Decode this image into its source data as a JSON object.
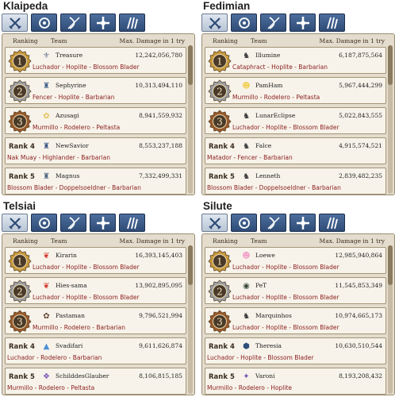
{
  "header": {
    "ranking": "Ranking",
    "team": "Team",
    "damage": "Max. Damage in 1 try"
  },
  "tabs": [
    {
      "icon": "swords-icon"
    },
    {
      "icon": "wizard-icon"
    },
    {
      "icon": "bow-icon"
    },
    {
      "icon": "cross-icon"
    },
    {
      "icon": "thief-icon"
    }
  ],
  "servers": [
    {
      "name": "Klaipeda",
      "rows": [
        {
          "rank": "1",
          "team": "Treasure",
          "damage": "12,242,056,780",
          "classes": "Luchador - Hoplite - Blossom Blader",
          "icon_color": "#6f7f93",
          "icon_glyph": "⚜"
        },
        {
          "rank": "2",
          "team": "Sephyrine",
          "damage": "10,313,494,110",
          "classes": "Fencer - Hoplite - Barbarian",
          "icon_color": "#3f5f8a",
          "icon_glyph": "♜"
        },
        {
          "rank": "3",
          "team": "Azusagi",
          "damage": "8,941,559,932",
          "classes": "Murmillo - Rodelero - Peltasta",
          "icon_color": "#e5c25a",
          "icon_glyph": "✿"
        },
        {
          "rank": "Rank 4",
          "team": "NewSavior",
          "damage": "8,553,237,188",
          "classes": "Nak Muay - Highlander - Barbarian",
          "icon_color": "#3a5686",
          "icon_glyph": "♜"
        },
        {
          "rank": "Rank 5",
          "team": "Magnus",
          "damage": "7,332,499,331",
          "classes": "Blossom Blader - Doppelsoeldner - Barbarian",
          "icon_color": "#4a6082",
          "icon_glyph": "♜"
        }
      ]
    },
    {
      "name": "Fedimian",
      "rows": [
        {
          "rank": "1",
          "team": "Illumine",
          "damage": "6,187,875,564",
          "classes": "Cataphract - Hoplite - Barbarian",
          "icon_color": "#3b3b3b",
          "icon_glyph": "♞"
        },
        {
          "rank": "2",
          "team": "PamHam",
          "damage": "5,967,444,299",
          "classes": "Murmillo - Rodelero - Peltasta",
          "icon_color": "#f2cf58",
          "icon_glyph": "☻"
        },
        {
          "rank": "3",
          "team": "LunarEclipse",
          "damage": "5,022,843,555",
          "classes": "Luchador - Hoplite - Blossom Blader",
          "icon_color": "#3b3b3b",
          "icon_glyph": "♞"
        },
        {
          "rank": "Rank 4",
          "team": "Falce",
          "damage": "4,915,574,521",
          "classes": "Matador - Fencer - Barbarian",
          "icon_color": "#3b3b3b",
          "icon_glyph": "♞"
        },
        {
          "rank": "Rank 5",
          "team": "Lenneth",
          "damage": "2,839,482,235",
          "classes": "Blossom Blader - Doppelsoeldner - Barbarian",
          "icon_color": "#3b3b3b",
          "icon_glyph": "♞"
        }
      ]
    },
    {
      "name": "Telsiai",
      "rows": [
        {
          "rank": "1",
          "team": "Kirarin",
          "damage": "16,393,145,403",
          "classes": "Luchador - Hoplite - Blossom Blader",
          "icon_color": "#d43a2f",
          "icon_glyph": "❦"
        },
        {
          "rank": "2",
          "team": "Hies-sama",
          "damage": "13,902,895,095",
          "classes": "Luchador - Hoplite - Blossom Blader",
          "icon_color": "#d43a2f",
          "icon_glyph": "❦"
        },
        {
          "rank": "3",
          "team": "Pastaman",
          "damage": "9,796,521,994",
          "classes": "Murmillo - Rodelero - Barbarian",
          "icon_color": "#6a4b3a",
          "icon_glyph": "✿"
        },
        {
          "rank": "Rank 4",
          "team": "Svadifari",
          "damage": "9,611,626,874",
          "classes": "Luchador - Rodelero - Barbarian",
          "icon_color": "#4b8fd6",
          "icon_glyph": "▲"
        },
        {
          "rank": "Rank 5",
          "team": "SchilddesGlauber",
          "damage": "8,106,815,185",
          "classes": "Murmillo - Rodelero - Peltasta",
          "icon_color": "#7b58b5",
          "icon_glyph": "❖"
        }
      ]
    },
    {
      "name": "Silute",
      "rows": [
        {
          "rank": "1",
          "team": "Loewe",
          "damage": "12,985,940,864",
          "classes": "Luchador - Hoplite - Blossom Blader",
          "icon_color": "#f2a0c8",
          "icon_glyph": "☻"
        },
        {
          "rank": "2",
          "team": "PeT",
          "damage": "11,545,853,349",
          "classes": "Luchador - Hoplite - Blossom Blader",
          "icon_color": "#3a4a3a",
          "icon_glyph": "◉"
        },
        {
          "rank": "3",
          "team": "Marquinhos",
          "damage": "10,974,665,173",
          "classes": "Luchador - Hoplite - Blossom Blader",
          "icon_color": "#3b3b3b",
          "icon_glyph": "♞"
        },
        {
          "rank": "Rank 4",
          "team": "Theresia",
          "damage": "10,630,510,544",
          "classes": "Luchador - Hoplite - Blossom Blader",
          "icon_color": "#2f4f7a",
          "icon_glyph": "⬢"
        },
        {
          "rank": "Rank 5",
          "team": "Varoni",
          "damage": "8,193,208,432",
          "classes": "Murmillo - Rodelero - Hoplite",
          "icon_color": "#7b58b5",
          "icon_glyph": "✦"
        }
      ]
    }
  ],
  "colors": {
    "gold": "#c99a3c",
    "silver": "#9ea2a8",
    "bronze": "#9a5a2c",
    "class_text": "#8a1d1d",
    "panel_bg": "#e4dccd",
    "tab_active": "#dfe6ef",
    "tab_bg": "#2f4c77"
  }
}
